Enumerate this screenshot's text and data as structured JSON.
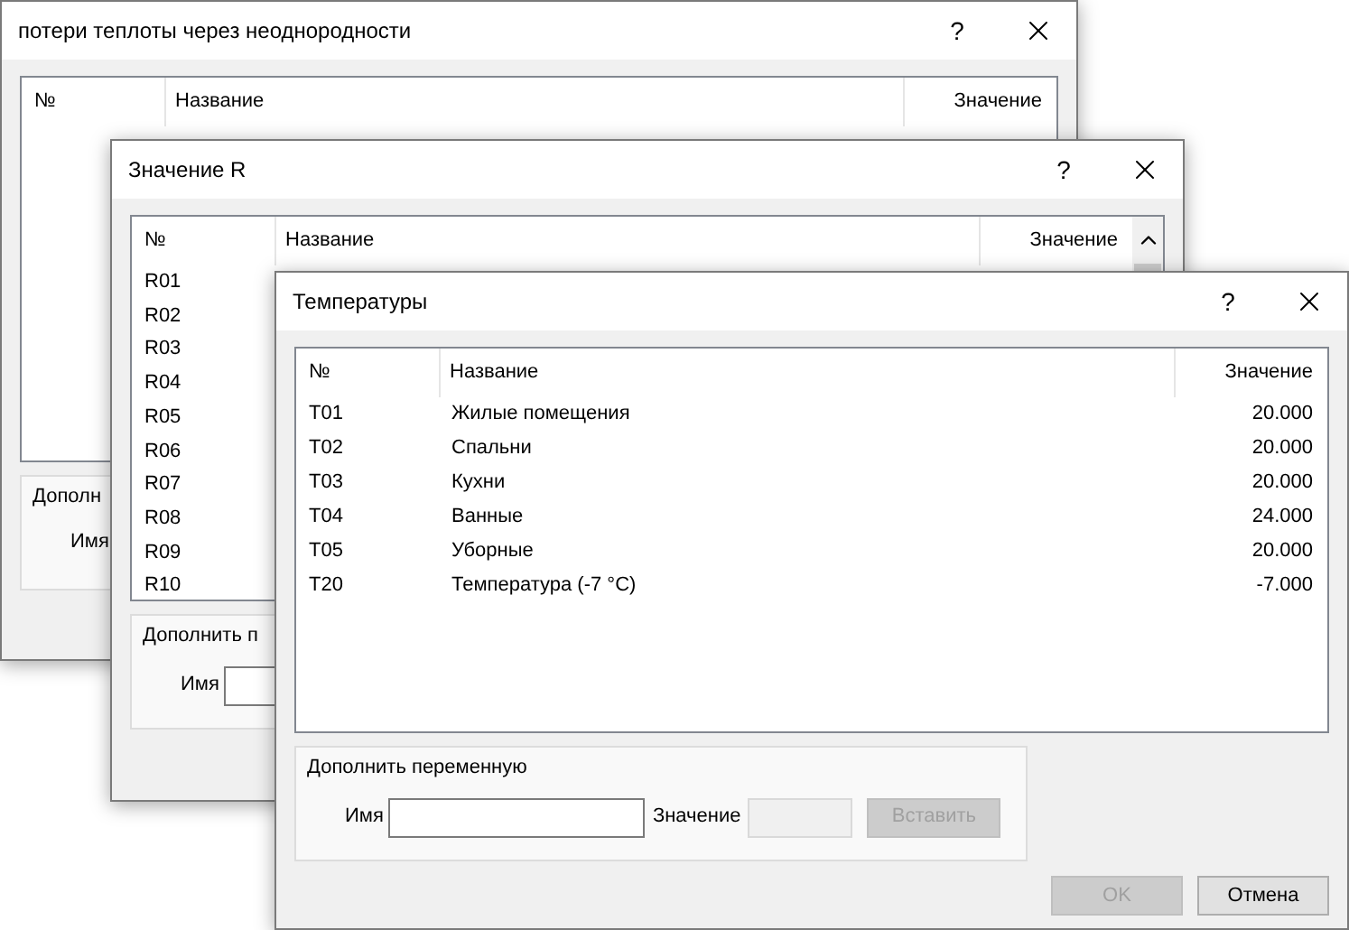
{
  "windows": [
    {
      "title": "потери теплоты через неоднородности",
      "help": "?",
      "table": {
        "columns": [
          "№",
          "Название",
          "Значение"
        ],
        "scrollable": false
      },
      "group": {
        "title": "Дополн",
        "name_label": "Имя"
      }
    },
    {
      "title": "Значение R",
      "help": "?",
      "table": {
        "columns": [
          "№",
          "Название",
          "Значение"
        ],
        "scrollable": true,
        "rows": [
          {
            "id": "R01"
          },
          {
            "id": "R02"
          },
          {
            "id": "R03"
          },
          {
            "id": "R04"
          },
          {
            "id": "R05"
          },
          {
            "id": "R06"
          },
          {
            "id": "R07"
          },
          {
            "id": "R08"
          },
          {
            "id": "R09"
          },
          {
            "id": "R10"
          }
        ]
      },
      "group": {
        "title": "Дополнить п",
        "name_label": "Имя",
        "name_field": true
      }
    },
    {
      "title": "Температуры",
      "help": "?",
      "table": {
        "columns": [
          "№",
          "Название",
          "Значение"
        ],
        "scrollable": false,
        "rows": [
          {
            "id": "T01",
            "name": "Жилые помещения",
            "value": "20.000"
          },
          {
            "id": "T02",
            "name": "Спальни",
            "value": "20.000"
          },
          {
            "id": "T03",
            "name": "Кухни",
            "value": "20.000"
          },
          {
            "id": "T04",
            "name": "Ванные",
            "value": "24.000"
          },
          {
            "id": "T05",
            "name": "Уборные",
            "value": "20.000"
          },
          {
            "id": "T20",
            "name": "Температура (-7 °C)",
            "value": "-7.000"
          }
        ]
      },
      "group": {
        "title": "Дополнить переменную",
        "name_label": "Имя",
        "name_field": true,
        "value_label": "Значение",
        "value_field": {
          "disabled": true
        },
        "insert_button": {
          "label": "Вставить",
          "disabled": true
        }
      },
      "buttons": [
        {
          "label": "OK",
          "disabled": true
        },
        {
          "label": "Отмена",
          "disabled": false
        }
      ]
    }
  ]
}
